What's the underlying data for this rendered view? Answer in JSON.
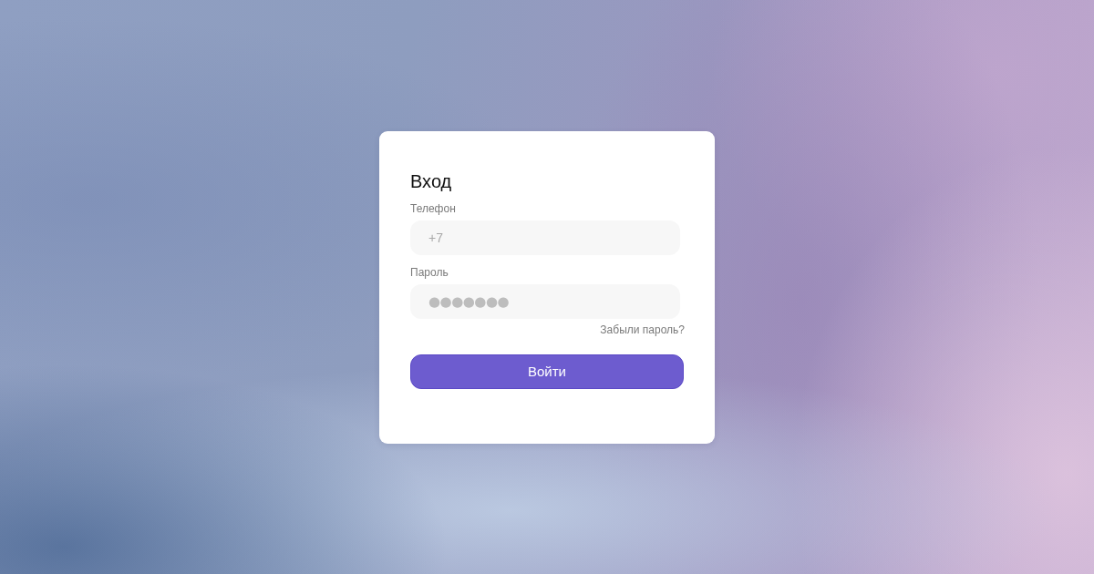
{
  "login_form": {
    "title": "Вход",
    "fields": [
      {
        "kind": "phone",
        "label": "Телефон",
        "placeholder": "+7"
      },
      {
        "kind": "password",
        "label": "Пароль",
        "value": "●●●●●●●"
      }
    ],
    "forgot_link": "Забыли пароль?",
    "submit_button": "Войти"
  }
}
